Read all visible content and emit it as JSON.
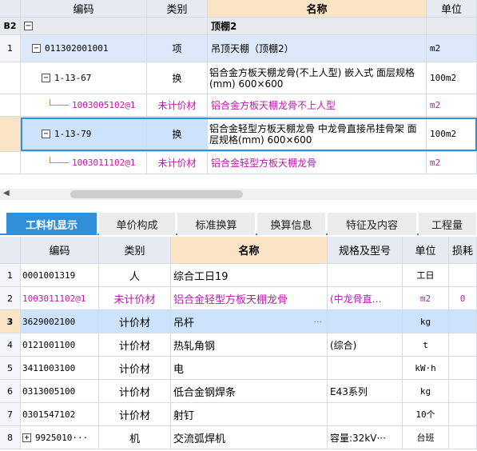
{
  "top_grid": {
    "headers": {
      "code": "编码",
      "type": "类别",
      "name": "名称",
      "unit": "单位"
    },
    "rows": [
      {
        "num": "B2",
        "code": "",
        "type": "",
        "name": "顶棚2",
        "unit": "",
        "toggle": "−"
      },
      {
        "num": "1",
        "code": "011302001001",
        "type": "项",
        "name": "吊顶天棚（顶棚2）",
        "unit": "m2",
        "toggle": "−"
      },
      {
        "num": "",
        "code": "1-13-67",
        "type": "换",
        "name": "铝合金方板天棚龙骨(不上人型) 嵌入式 面层规格(mm) 600×600",
        "unit": "100m2",
        "toggle": "−"
      },
      {
        "num": "",
        "code": "1003005102@1",
        "type": "未计价材",
        "name": "铝合金方板天棚龙骨不上人型",
        "unit": "m2"
      },
      {
        "num": "",
        "code": "1-13-79",
        "type": "换",
        "name": "铝合金轻型方板天棚龙骨 中龙骨直接吊挂骨架 面层规格(mm) 600×600",
        "unit": "100m2",
        "toggle": "−"
      },
      {
        "num": "",
        "code": "1003011102@1",
        "type": "未计价材",
        "name": "铝合金轻型方板天棚龙骨",
        "unit": "m2"
      }
    ]
  },
  "tabs": [
    "工料机显示",
    "单价构成",
    "标准换算",
    "换算信息",
    "特征及内容",
    "工程量"
  ],
  "bottom_grid": {
    "headers": {
      "code": "编码",
      "type": "类别",
      "name": "名称",
      "spec": "规格及型号",
      "unit": "单位",
      "loss": "损耗"
    },
    "rows": [
      {
        "num": "1",
        "code": "0001001319",
        "type": "人",
        "name": "综合工日19",
        "spec": "",
        "unit": "工日",
        "loss": ""
      },
      {
        "num": "2",
        "code": "1003011102@1",
        "type": "未计价材",
        "name": "铝合金轻型方板天棚龙骨",
        "spec": "(中龙骨直…",
        "unit": "m2",
        "loss": "0"
      },
      {
        "num": "3",
        "code": "3629002100",
        "type": "计价材",
        "name": "吊杆",
        "spec": "",
        "unit": "kg",
        "loss": ""
      },
      {
        "num": "4",
        "code": "0121001100",
        "type": "计价材",
        "name": "热轧角钢",
        "spec": "(综合)",
        "unit": "t",
        "loss": ""
      },
      {
        "num": "5",
        "code": "3411003100",
        "type": "计价材",
        "name": "电",
        "spec": "",
        "unit": "kW·h",
        "loss": ""
      },
      {
        "num": "6",
        "code": "0313005100",
        "type": "计价材",
        "name": "低合金钢焊条",
        "spec": "E43系列",
        "unit": "kg",
        "loss": ""
      },
      {
        "num": "7",
        "code": "0301547102",
        "type": "计价材",
        "name": "射钉",
        "spec": "",
        "unit": "10个",
        "loss": ""
      },
      {
        "num": "8",
        "code": "9925010···",
        "type": "机",
        "name": "交流弧焊机",
        "spec": "容量:32kV···",
        "unit": "台班",
        "loss": "",
        "toggle": "+"
      }
    ],
    "ellipsis": "···"
  },
  "colors": {
    "accent": "#2f8fd8",
    "purple": "#b51fa8",
    "header_bg": "#e6eaf1",
    "name_header_bg": "#fbe3c6",
    "selected_bg": "#cde3fb"
  }
}
